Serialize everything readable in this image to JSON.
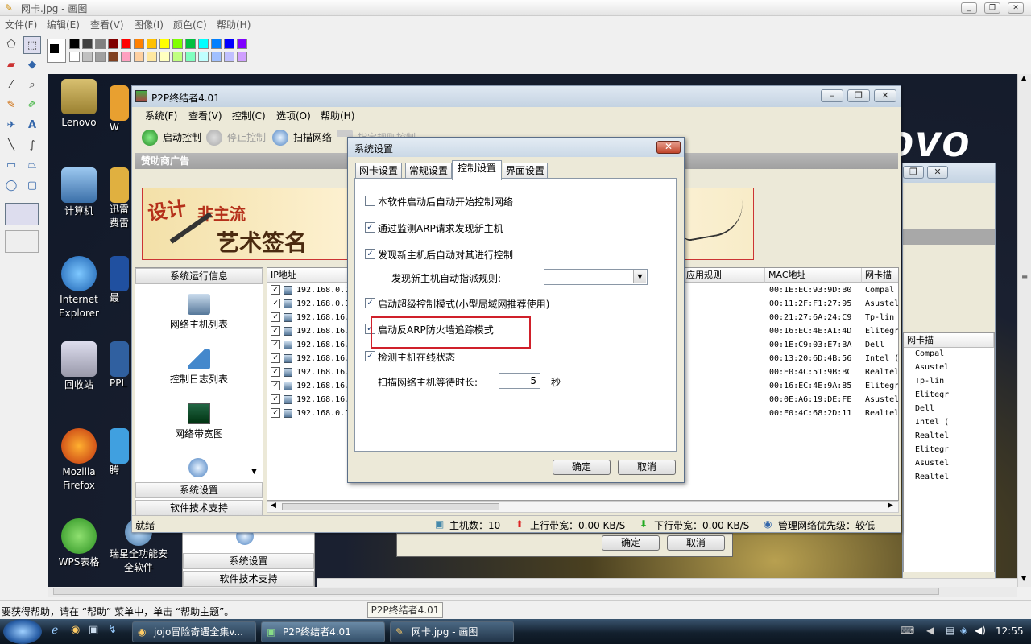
{
  "paint": {
    "title": "网卡.jpg - 画图",
    "menu": [
      "文件(F)",
      "编辑(E)",
      "查看(V)",
      "图像(I)",
      "颜色(C)",
      "帮助(H)"
    ],
    "status": "要获得帮助，请在 “帮助” 菜单中，单击 “帮助主题”。",
    "tooltip": "P2P终结者4.01",
    "palette_top": [
      "#000000",
      "#404040",
      "#808080",
      "#800000",
      "#ff0000",
      "#ff8000",
      "#ffc000",
      "#ffff00",
      "#80ff00",
      "#00c040",
      "#00ffff",
      "#0080ff",
      "#0000ff",
      "#8000ff"
    ],
    "palette_bottom": [
      "#ffffff",
      "#c0c0c0",
      "#a0a0a0",
      "#804020",
      "#ffa0c0",
      "#ffd0a0",
      "#ffe8a0",
      "#ffffc0",
      "#c0ff80",
      "#80ffc0",
      "#c0ffff",
      "#a0c0ff",
      "#c0c0ff",
      "#d0a0ff"
    ]
  },
  "desktop": {
    "icons": [
      "Lenovo",
      "计算机",
      "Internet Explorer",
      "回收站",
      "Mozilla Firefox",
      "WPS表格",
      "瑞星全功能安全软件",
      "W",
      "迅雷",
      "费雷",
      "最",
      "PPL",
      "腾"
    ],
    "background_text": "ovo"
  },
  "p2p": {
    "title": "P2P终结者4.01",
    "menu": [
      "系统(F)",
      "查看(V)",
      "控制(C)",
      "选项(O)",
      "帮助(H)"
    ],
    "toolbar": [
      "启动控制",
      "停止控制",
      "扫描网络",
      "指定规则控制"
    ],
    "sponsor_label": "赞助商广告",
    "banner_text": [
      "设计",
      "非主流",
      "艺术签名"
    ],
    "left_header": "系统运行信息",
    "left_items": [
      "网络主机列表",
      "控制日志列表",
      "网络带宽图"
    ],
    "left_bottom": [
      "系统设置",
      "软件技术支持"
    ],
    "columns": [
      "IP地址",
      "应用规则",
      "MAC地址",
      "网卡描"
    ],
    "rows": [
      {
        "ip": "192.168.0.1",
        "mac": "00:1E:EC:93:9D:B0",
        "nic": "Compal"
      },
      {
        "ip": "192.168.0.1",
        "mac": "00:11:2F:F1:27:95",
        "nic": "Asustel"
      },
      {
        "ip": "192.168.16.",
        "mac": "00:21:27:6A:24:C9",
        "nic": "Tp-lin"
      },
      {
        "ip": "192.168.16.",
        "mac": "00:16:EC:4E:A1:4D",
        "nic": "Elitegr"
      },
      {
        "ip": "192.168.16.",
        "mac": "00:1E:C9:03:E7:BA",
        "nic": "Dell"
      },
      {
        "ip": "192.168.16.",
        "mac": "00:13:20:6D:4B:56",
        "nic": "Intel ("
      },
      {
        "ip": "192.168.16.",
        "mac": "00:E0:4C:51:9B:BC",
        "nic": "Realtel"
      },
      {
        "ip": "192.168.16.",
        "mac": "00:16:EC:4E:9A:85",
        "nic": "Elitegr"
      },
      {
        "ip": "192.168.16.",
        "mac": "00:0E:A6:19:DE:FE",
        "nic": "Asustel"
      },
      {
        "ip": "192.168.0.1",
        "mac": "00:E0:4C:68:2D:11",
        "nic": "Realtel"
      }
    ],
    "status": {
      "ready": "就绪",
      "hosts": "主机数：10",
      "up": "上行带宽：0.00 KB/S",
      "down": "下行带宽：0.00 KB/S",
      "priority": "管理网络优先级：较低"
    }
  },
  "back_window": {
    "nic_header": "网卡描",
    "nic_list": [
      "Compal",
      "Asustel",
      "Tp-lin",
      "Elitegr",
      "Dell",
      "Intel (",
      "Realtel",
      "Elitegr",
      "Asustel",
      "Realtel"
    ],
    "left_bottom": [
      "系统设置",
      "软件技术支持"
    ],
    "ok": "确定",
    "cancel": "取消"
  },
  "dialog": {
    "title": "系统设置",
    "tabs": [
      "网卡设置",
      "常规设置",
      "控制设置",
      "界面设置"
    ],
    "options": [
      {
        "label": "本软件启动后自动开始控制网络",
        "checked": false
      },
      {
        "label": "通过监测ARP请求发现新主机",
        "checked": true
      },
      {
        "label": "发现新主机后自动对其进行控制",
        "checked": true
      },
      {
        "label": "启动超级控制模式(小型局域网推荐使用)",
        "checked": true
      },
      {
        "label": "启动反ARP防火墙追踪模式",
        "checked": true
      },
      {
        "label": "检测主机在线状态",
        "checked": true
      }
    ],
    "rule_label": "发现新主机自动指派规则:",
    "rule_value": "",
    "scan_label": "扫描网络主机等待时长:",
    "scan_value": "5",
    "scan_unit": "秒",
    "ok": "确定",
    "cancel": "取消"
  },
  "taskbar": {
    "tasks": [
      "jojo冒险奇遇全集v...",
      "P2P终结者4.01",
      "网卡.jpg - 画图"
    ],
    "time": "12:55"
  }
}
